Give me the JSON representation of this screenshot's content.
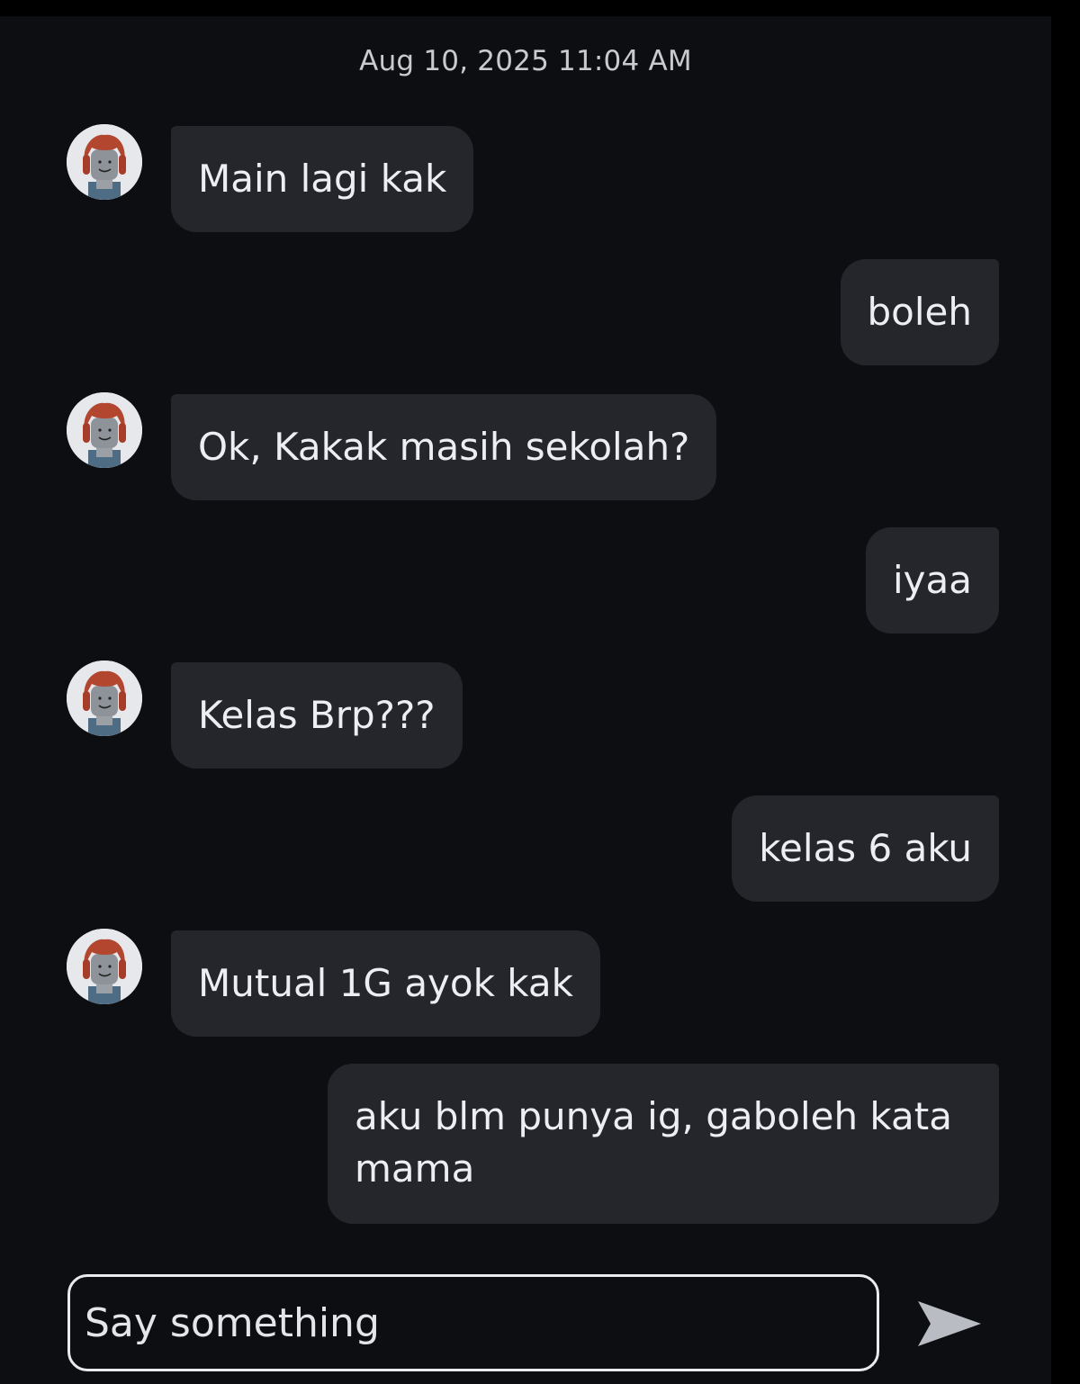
{
  "chat": {
    "timestamp": "Aug 10, 2025 11:04 AM",
    "messages": [
      {
        "sender": "other",
        "text": "Main lagi kak"
      },
      {
        "sender": "me",
        "text": "boleh"
      },
      {
        "sender": "other",
        "text": "Ok, Kakak masih sekolah?"
      },
      {
        "sender": "me",
        "text": "iyaa"
      },
      {
        "sender": "other",
        "text": "Kelas Brp???"
      },
      {
        "sender": "me",
        "text": "kelas 6 aku"
      },
      {
        "sender": "other",
        "text": "Mutual 1G ayok kak"
      },
      {
        "sender": "me",
        "text": "aku blm punya ig, gaboleh kata mama"
      }
    ]
  },
  "composer": {
    "placeholder": "Say something",
    "send_icon": "send-icon"
  },
  "colors": {
    "background": "#0d0e11",
    "bubble": "#24262c",
    "text": "#eceef2"
  }
}
